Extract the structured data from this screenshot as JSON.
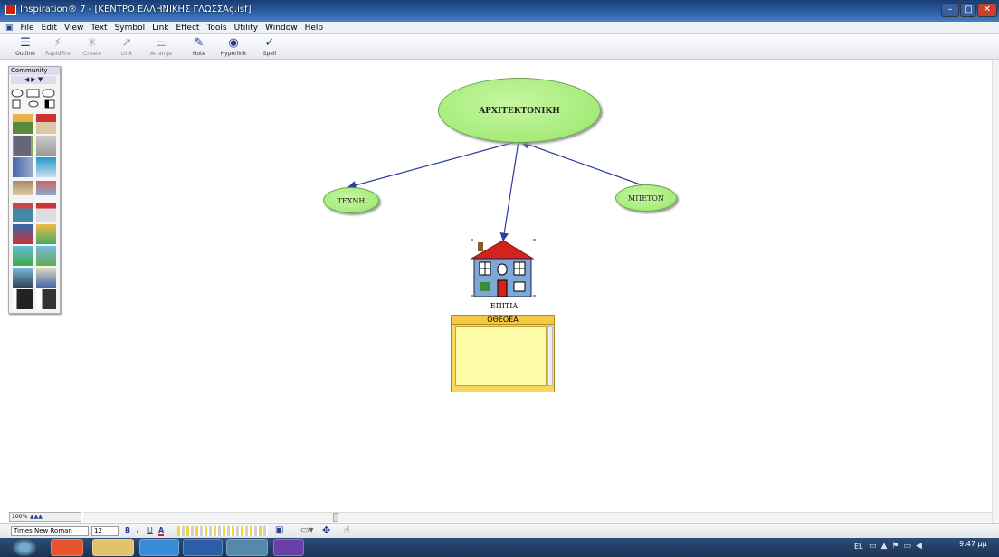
{
  "window": {
    "title": "Inspiration® 7 - [ΚΕΝΤΡΟ ΕΛΛΗΝΙΚΗΣ ΓΛΩΣΣΑς.isf]"
  },
  "menu": [
    "File",
    "Edit",
    "View",
    "Text",
    "Symbol",
    "Link",
    "Effect",
    "Tools",
    "Utility",
    "Window",
    "Help"
  ],
  "toolbar": [
    {
      "label": "Outline",
      "icon": "outline-icon",
      "enabled": true
    },
    {
      "label": "RapidFire",
      "icon": "rapidfire-icon",
      "enabled": false
    },
    {
      "label": "Create",
      "icon": "create-icon",
      "enabled": false
    },
    {
      "label": "Link",
      "icon": "link-icon",
      "enabled": false
    },
    {
      "label": "Arrange",
      "icon": "arrange-icon",
      "enabled": false
    },
    {
      "label": "Note",
      "icon": "note-icon",
      "enabled": true
    },
    {
      "label": "Hyperlink",
      "icon": "hyperlink-icon",
      "enabled": true
    },
    {
      "label": "Spell",
      "icon": "spell-icon",
      "enabled": true
    }
  ],
  "palette": {
    "title": "Community"
  },
  "diagram": {
    "main_node": "ΑΡΧΙΤΕΚΤΟΝΙΚΗ",
    "node_left": "ΤΕΧΝΗ",
    "node_right": "ΜΠΕΤΟΝ",
    "house_label": "ΕΠΙΤΙΑ",
    "note_title": "ΟΘΕΟΕΑ"
  },
  "zoom": "100%",
  "format": {
    "font": "Times New Roman",
    "size": "12",
    "bold": "B",
    "italic": "I",
    "underline": "U",
    "color": "A"
  },
  "colors": {
    "node_fill": "#a8ee7c",
    "link": "#2b3f9a",
    "note": "#f8d75a",
    "titlebar": "#2b5fa6"
  },
  "tray": {
    "lang": "EL",
    "time": "9:47 μμ"
  }
}
